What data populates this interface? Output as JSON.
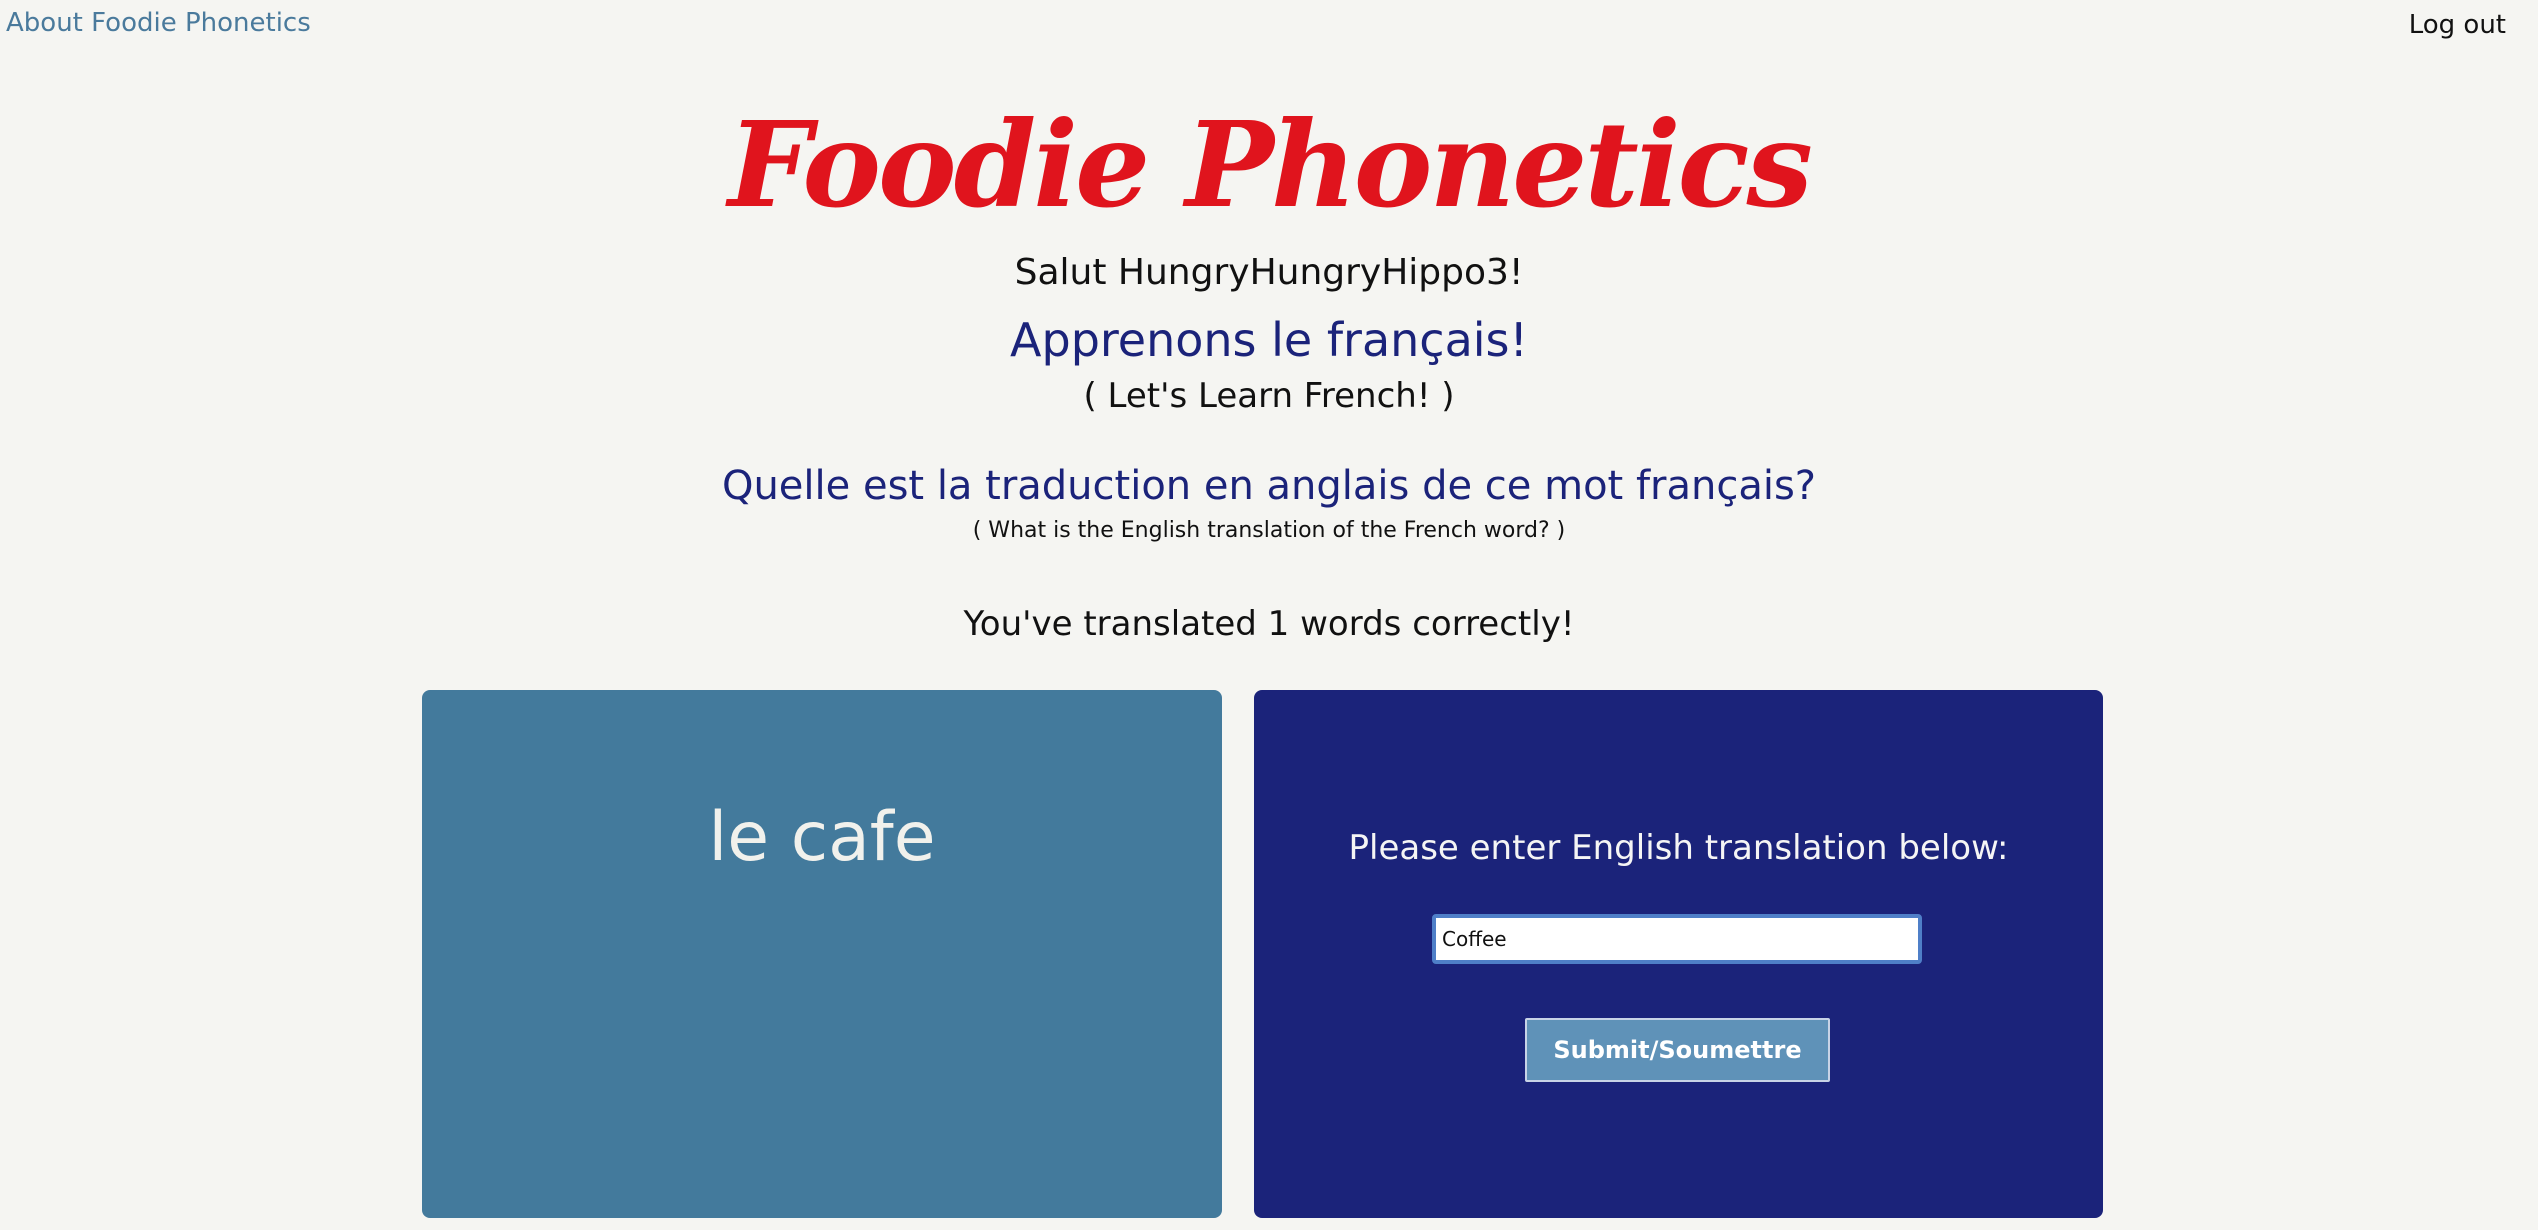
{
  "nav": {
    "about_label": "About Foodie Phonetics",
    "logout_label": "Log out"
  },
  "header": {
    "logo_text": "Foodie Phonetics",
    "greeting": "Salut HungryHungryHippo3!",
    "subtitle_fr": "Apprenons le français!",
    "subtitle_en": "( Let's Learn French! )"
  },
  "question": {
    "fr": "Quelle est la traduction en anglais de ce mot français?",
    "en": "( What is the English translation of the French word? )"
  },
  "score_text": "You've translated 1 words correctly!",
  "word_card": {
    "french_word": "le cafe"
  },
  "input_card": {
    "prompt": "Please enter English translation below:",
    "input_value": "Coffee",
    "submit_label": "Submit/Soumettre"
  },
  "colors": {
    "background": "#f5f5f2",
    "logo": "#e0141d",
    "heading_blue": "#1b237a",
    "word_card": "#437a9c",
    "input_card": "#1b237a",
    "button": "#5f92b8"
  }
}
